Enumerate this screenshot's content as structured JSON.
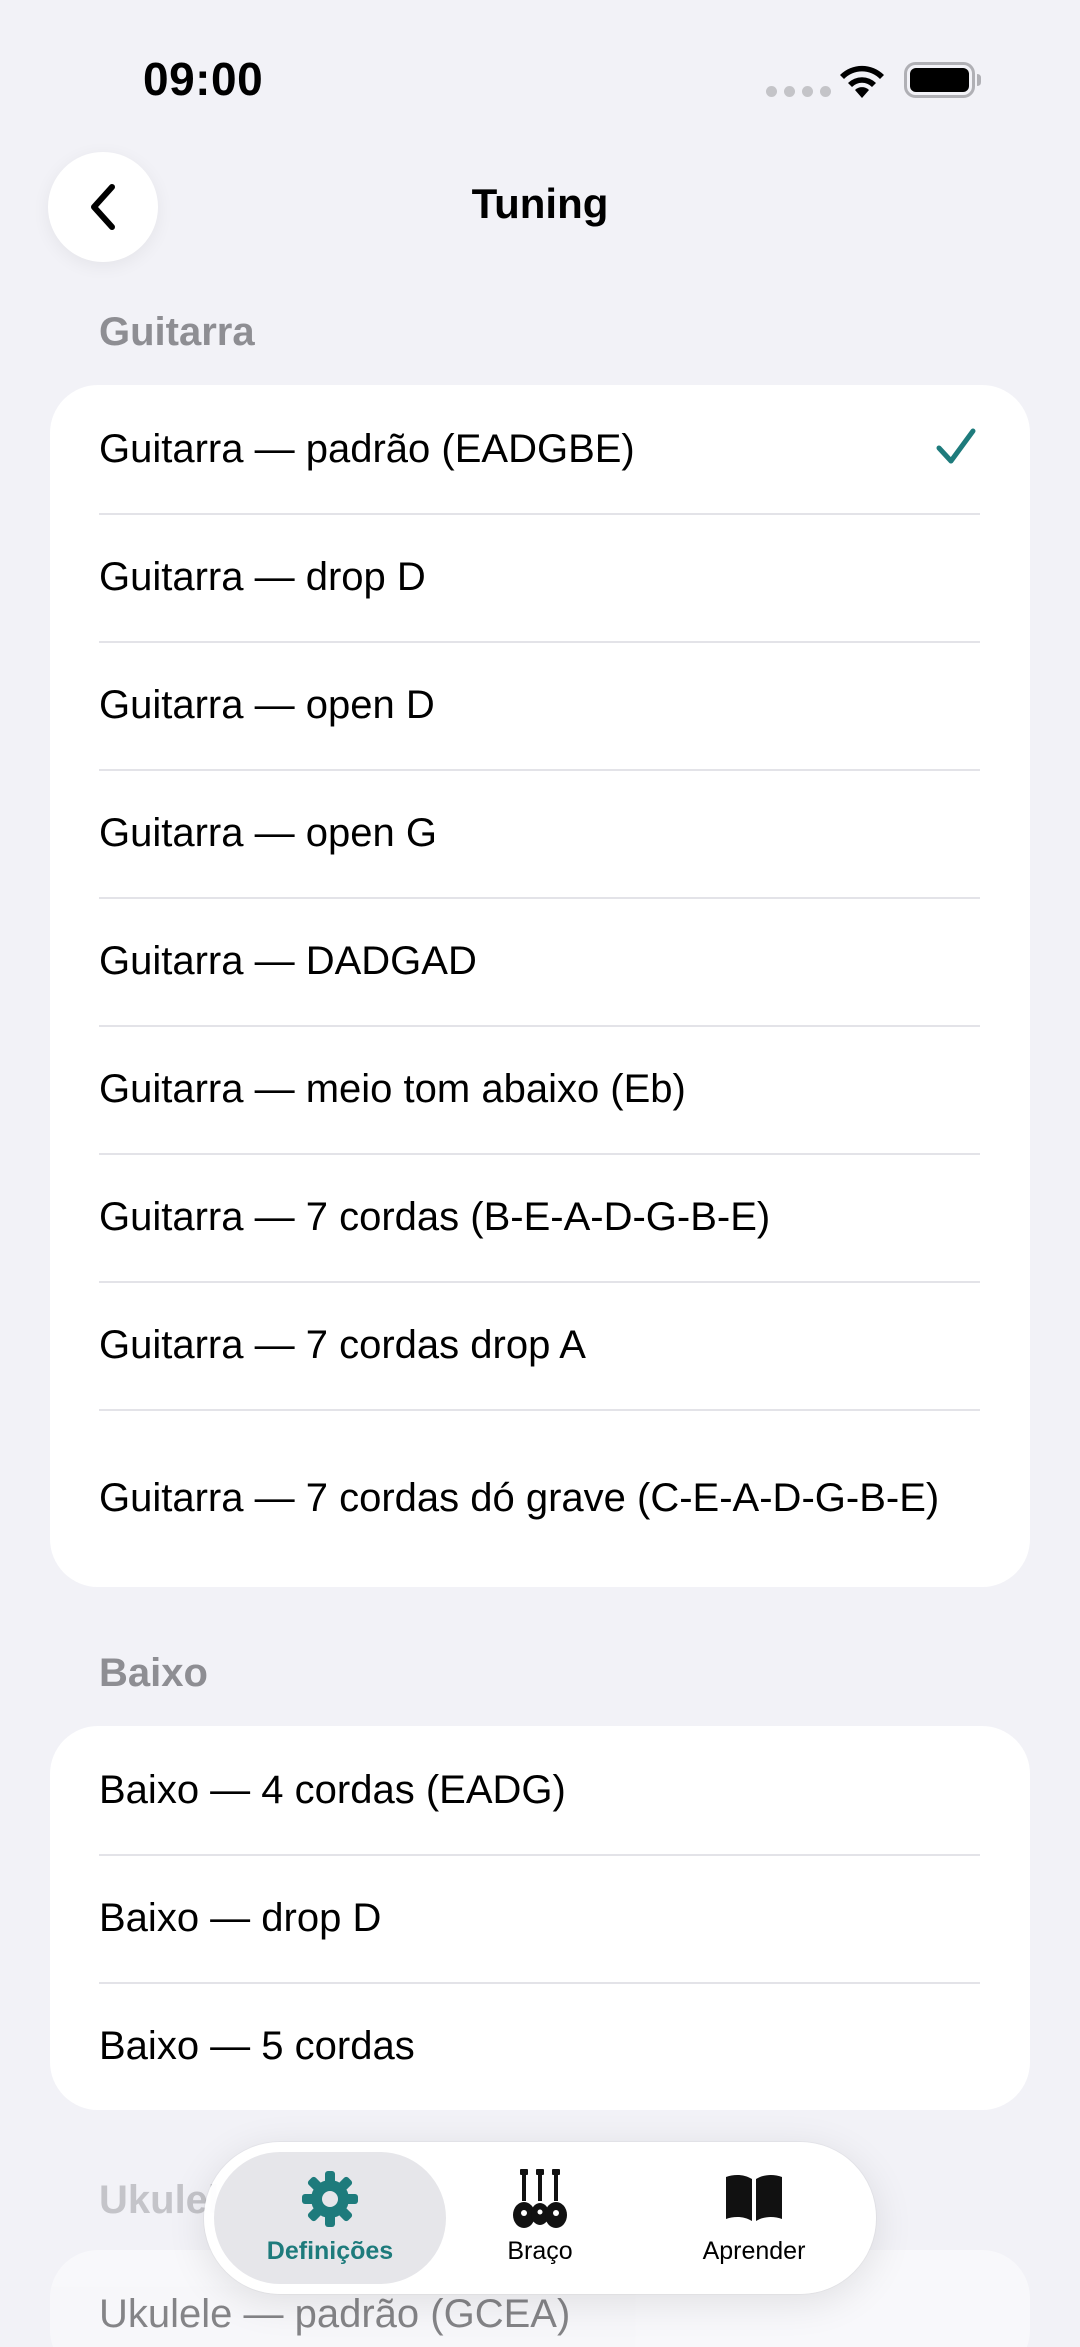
{
  "status": {
    "time": "09:00"
  },
  "nav": {
    "title": "Tuning"
  },
  "sections": [
    {
      "header": "Guitarra",
      "items": [
        {
          "label": "Guitarra — padrão (EADGBE)",
          "selected": true
        },
        {
          "label": "Guitarra — drop D"
        },
        {
          "label": "Guitarra — open D"
        },
        {
          "label": "Guitarra — open G"
        },
        {
          "label": "Guitarra — DADGAD"
        },
        {
          "label": "Guitarra — meio tom abaixo (Eb)"
        },
        {
          "label": "Guitarra — 7 cordas (B-E-A-D-G-B-E)"
        },
        {
          "label": "Guitarra — 7 cordas drop A"
        },
        {
          "label": "Guitarra — 7 cordas dó grave (C-E-A-D-G-B-E)"
        }
      ]
    },
    {
      "header": "Baixo",
      "items": [
        {
          "label": "Baixo — 4 cordas (EADG)"
        },
        {
          "label": "Baixo — drop D"
        },
        {
          "label": "Baixo — 5 cordas"
        }
      ]
    },
    {
      "header": "Ukulele",
      "items": [
        {
          "label": "Ukulele — padrão (GCEA)"
        }
      ]
    }
  ],
  "tab_bar": {
    "tabs": [
      {
        "label": "Definições",
        "icon": "gear-icon",
        "active": true
      },
      {
        "label": "Braço",
        "icon": "instruments-icon",
        "active": false
      },
      {
        "label": "Aprender",
        "icon": "book-icon",
        "active": false
      }
    ]
  },
  "colors": {
    "accent": "#1e7b7c",
    "background": "#f2f2f7",
    "secondary_text": "#8e8e93"
  }
}
